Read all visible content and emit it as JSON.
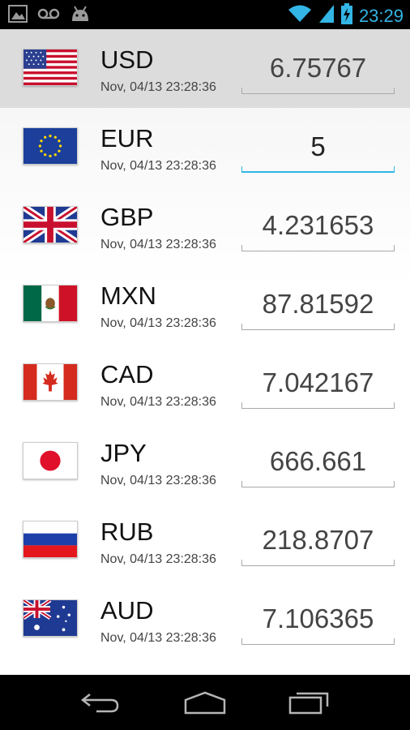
{
  "status_bar": {
    "time": "23:29",
    "left_icons": [
      "gallery-icon",
      "voicemail-icon",
      "android-debug-icon"
    ],
    "right_icons": [
      "wifi-icon",
      "signal-icon",
      "battery-charging-icon"
    ],
    "accent": "#33b5e5"
  },
  "currencies": [
    {
      "code": "USD",
      "timestamp": "Nov, 04/13 23:28:36",
      "value": "6.75767",
      "flag": "us-flag-icon"
    },
    {
      "code": "EUR",
      "timestamp": "Nov, 04/13 23:28:36",
      "value": "5",
      "flag": "eu-flag-icon"
    },
    {
      "code": "GBP",
      "timestamp": "Nov, 04/13 23:28:36",
      "value": "4.231653",
      "flag": "uk-flag-icon"
    },
    {
      "code": "MXN",
      "timestamp": "Nov, 04/13 23:28:36",
      "value": "87.81592",
      "flag": "mexico-flag-icon"
    },
    {
      "code": "CAD",
      "timestamp": "Nov, 04/13 23:28:36",
      "value": "7.042167",
      "flag": "canada-flag-icon"
    },
    {
      "code": "JPY",
      "timestamp": "Nov, 04/13 23:28:36",
      "value": "666.661",
      "flag": "japan-flag-icon"
    },
    {
      "code": "RUB",
      "timestamp": "Nov, 04/13 23:28:36",
      "value": "218.8707",
      "flag": "russia-flag-icon"
    },
    {
      "code": "AUD",
      "timestamp": "Nov, 04/13 23:28:36",
      "value": "7.106365",
      "flag": "australia-flag-icon"
    }
  ],
  "nav_bar": {
    "buttons": [
      "back-icon",
      "home-icon",
      "recent-apps-icon"
    ]
  }
}
